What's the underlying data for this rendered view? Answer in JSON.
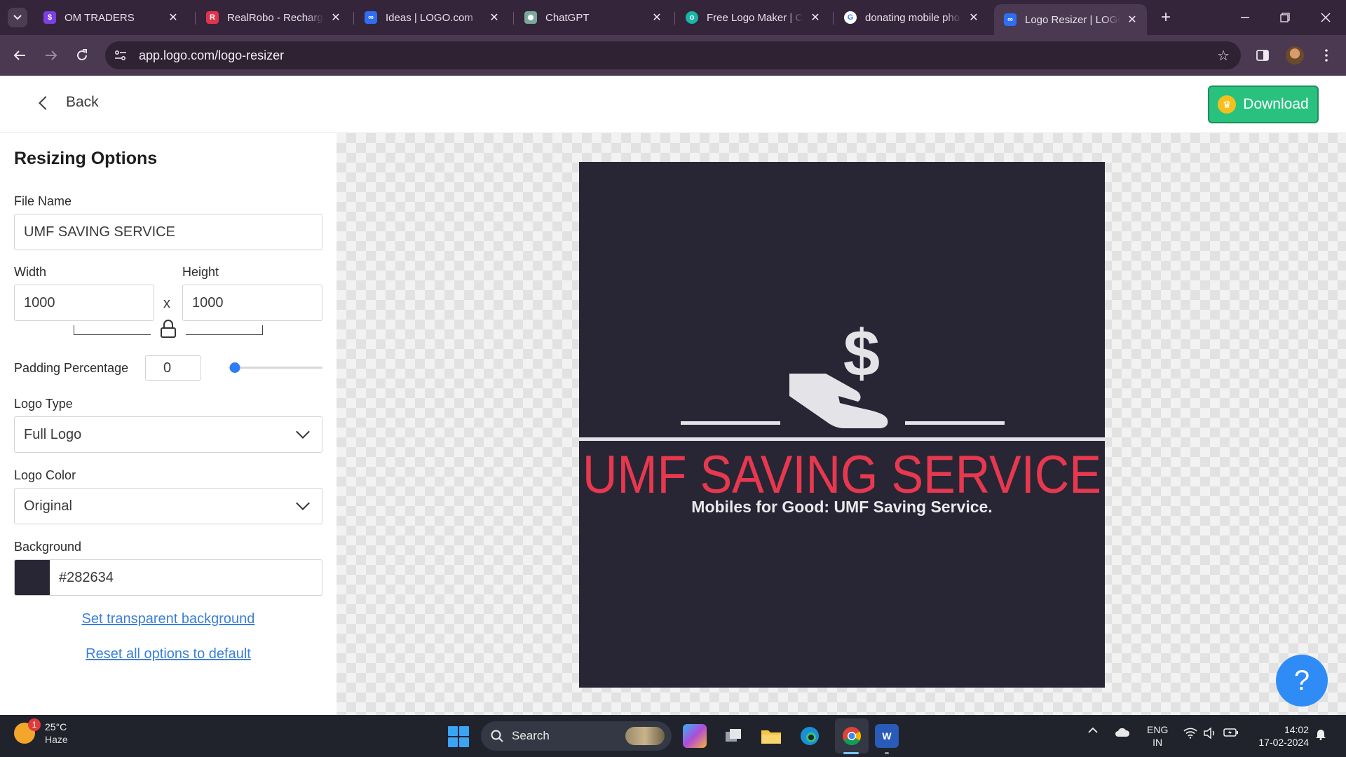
{
  "browser": {
    "tabs": [
      {
        "title": "OM TRADERS",
        "favicon": "om-traders-favicon",
        "color": "#7b3fe4"
      },
      {
        "title": "RealRobo - Recharge",
        "favicon": "realrobo-favicon",
        "color": "#e0344d"
      },
      {
        "title": "Ideas | LOGO.com",
        "favicon": "logo-com-favicon",
        "color": "#2f6ef2"
      },
      {
        "title": "ChatGPT",
        "favicon": "chatgpt-favicon",
        "color": "#7aa89a"
      },
      {
        "title": "Free Logo Maker | Cr",
        "favicon": "free-logo-maker-favicon",
        "color": "#18b6a8"
      },
      {
        "title": "donating mobile pho",
        "favicon": "google-favicon",
        "color": "#ffffff"
      },
      {
        "title": "Logo Resizer | LOGO.",
        "favicon": "logo-com-favicon",
        "color": "#2f6ef2"
      }
    ],
    "url": "app.logo.com/logo-resizer"
  },
  "header": {
    "back_label": "Back",
    "download_label": "Download"
  },
  "sidebar": {
    "title": "Resizing Options",
    "file_name_label": "File Name",
    "file_name_value": "UMF SAVING SERVICE",
    "width_label": "Width",
    "width_value": "1000",
    "height_label": "Height",
    "height_value": "1000",
    "times": "x",
    "padding_label": "Padding Percentage",
    "padding_value": "0",
    "padding_slider_fraction": 0,
    "logo_type_label": "Logo Type",
    "logo_type_value": "Full Logo",
    "logo_color_label": "Logo Color",
    "logo_color_value": "Original",
    "background_label": "Background",
    "background_value": "#282634",
    "transparent_link": "Set transparent background",
    "reset_link": "Reset all options to default"
  },
  "logo": {
    "background": "#282634",
    "name": "UMF SAVING SERVICE",
    "tagline": "Mobiles for Good: UMF Saving Service.",
    "name_color": "#e8384f",
    "tagline_color": "#e9e9ec",
    "icon_color": "#e4e4e8",
    "symbol": "$"
  },
  "help": {
    "label": "?"
  },
  "taskbar": {
    "temp": "25°C",
    "weather": "Haze",
    "notification_count": "1",
    "search_label": "Search",
    "lang_line1": "ENG",
    "lang_line2": "IN",
    "time": "14:02",
    "date": "17-02-2024"
  }
}
